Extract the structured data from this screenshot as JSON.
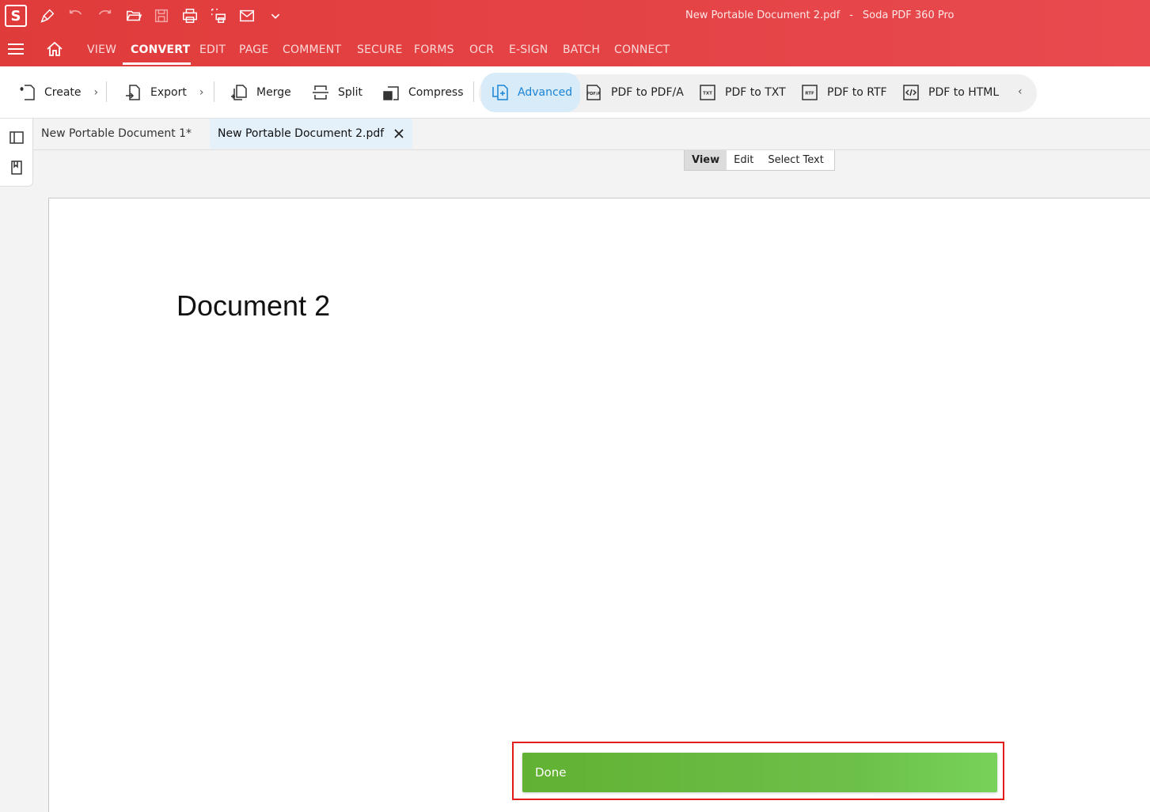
{
  "window": {
    "title": "New Portable Document 2.pdf",
    "separator": "-",
    "app_name": "Soda PDF 360 Pro",
    "logo_letter": "S"
  },
  "quick_access": [
    "pen-icon",
    "undo-icon",
    "redo-icon",
    "open-folder-icon",
    "save-icon",
    "print-icon",
    "print-preview-icon",
    "mail-icon",
    "chevron-down-icon"
  ],
  "menu": {
    "items": [
      "VIEW",
      "CONVERT",
      "EDIT",
      "PAGE",
      "COMMENT",
      "SECURE",
      "FORMS",
      "OCR",
      "E-SIGN",
      "BATCH",
      "CONNECT"
    ],
    "active": "CONVERT"
  },
  "toolbar": {
    "create": "Create",
    "export": "Export",
    "merge": "Merge",
    "split": "Split",
    "compress": "Compress",
    "advanced": "Advanced",
    "pdf_to_pdfa": "PDF to PDF/A",
    "pdf_to_txt": "PDF to TXT",
    "pdf_to_rtf": "PDF to RTF",
    "pdf_to_html": "PDF to HTML"
  },
  "tabs": [
    {
      "label": "New Portable Document 1*",
      "active": false
    },
    {
      "label": "New Portable Document 2.pdf",
      "active": true
    }
  ],
  "mode_switch": {
    "view": "View",
    "edit": "Edit",
    "select_text": "Select Text",
    "active": "View"
  },
  "document": {
    "heading": "Document 2"
  },
  "notification": {
    "text": "Done",
    "color": "#6ab83e"
  },
  "colors": {
    "brand": "#e03b3b",
    "accent": "#1a84d6",
    "highlight": "#e21b1b"
  }
}
